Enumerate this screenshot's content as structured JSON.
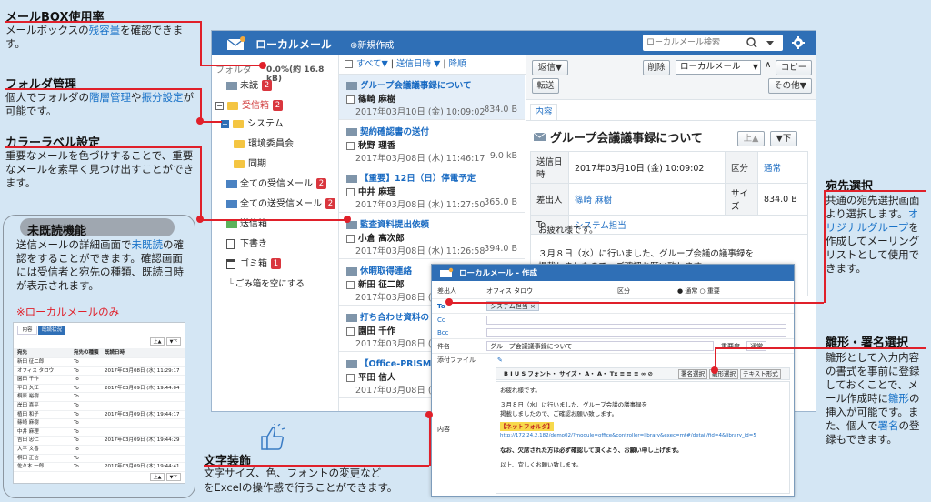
{
  "annotations": {
    "mailbox": {
      "title": "メールBOX使用率",
      "text1": "メールボックスの",
      "text2": "残容量",
      "text3": "を確認できます。"
    },
    "folder": {
      "title": "フォルダ管理",
      "text1": "個人でフォルダの",
      "text2": "階層管理",
      "text3": "や",
      "text4": "振分設定",
      "text5": "が可能です。"
    },
    "color": {
      "title": "カラーラベル設定",
      "text": "重要なメールを色づけすることで、重要なメールを素早く見つけ出すことができます。"
    },
    "unread": {
      "title": "未既読機能",
      "text1": "送信メールの詳細画面で",
      "text2": "未既読",
      "text3": "の確認をすることができます。確認画面には受信者と宛先の種類、既読日時が表示されます。",
      "note": "※ローカルメールのみ"
    },
    "recipient": {
      "title": "宛先選択",
      "text1": "共通の宛先選択画面より選択します。",
      "text2": "オリジナルグループ",
      "text3": "を作成してメーリングリストとして使用できます。"
    },
    "template": {
      "title": "雛形・署名選択",
      "text1": "雛形として入力内容の書式を事前に登録しておくことで、メール作成時に",
      "text2": "雛形",
      "text3": "の挿入が可能です。また、個人で",
      "text4": "署名",
      "text5": "の登録もできます。"
    },
    "deco": {
      "title": "文字装飾",
      "text1": "文字サイズ、色、フォントの変更など",
      "text2": "をExcelの操作感で行うことができます。"
    }
  },
  "app": {
    "title": "ローカルメール",
    "new_button": "⊕新規作成",
    "search_placeholder": "ローカルメール検索",
    "folder_label": "フォルダ",
    "usage": "0.0%(約 16.8 kB)",
    "folders": [
      {
        "label": "未読",
        "badge": "2"
      },
      {
        "label": "受信箱",
        "badge": "2"
      },
      {
        "label": "システム",
        "badge": ""
      },
      {
        "label": "環境委員会",
        "badge": ""
      },
      {
        "label": "同期",
        "badge": ""
      },
      {
        "label": "全ての受信メール",
        "badge": "2"
      },
      {
        "label": "全ての送受信メール",
        "badge": "2"
      },
      {
        "label": "送信箱",
        "badge": ""
      },
      {
        "label": "下書き",
        "badge": ""
      },
      {
        "label": "ゴミ箱",
        "badge": "1"
      },
      {
        "label": "ごみ箱を空にする",
        "badge": ""
      }
    ],
    "list_toolbar": {
      "all": "すべて▼",
      "sort": "送信日時 ▼",
      "order": "降順"
    },
    "mails": [
      {
        "subject": "グループ会議議事録について",
        "from": "篠崎 麻樹",
        "date": "2017年03月10日 (金) 10:09:02",
        "size": "834.0 B"
      },
      {
        "subject": "契約確認書の送付",
        "from": "秋野 理香",
        "date": "2017年03月08日 (水) 11:46:17",
        "size": "9.0 kB"
      },
      {
        "subject": "【重要】12日（日）停電予定",
        "from": "中井 麻理",
        "date": "2017年03月08日 (水) 11:27:50",
        "size": "365.0 B"
      },
      {
        "subject": "監査資料提出依頼",
        "from": "小倉 高次郎",
        "date": "2017年03月08日 (水) 11:26:58",
        "size": "394.0 B"
      },
      {
        "subject": "休暇取得連絡",
        "from": "新田 征二郎",
        "date": "2017年03月08日 (水)",
        "size": ""
      },
      {
        "subject": "打ち合わせ資料の",
        "from": "園田 千作",
        "date": "2017年03月08日 (水)",
        "size": ""
      },
      {
        "subject": "【Office-PRISM】",
        "from": "平田 信人",
        "date": "2017年03月08日 (水)",
        "size": ""
      }
    ],
    "detail": {
      "reply": "返信▼",
      "forward": "転送",
      "delete": "削除",
      "move_select": "ローカルメール",
      "copy": "コピー",
      "other": "その他▼",
      "tab": "内容",
      "subject": "グループ会議議事録について",
      "prev": "上▲",
      "next": "▼下",
      "labels": {
        "sent": "送信日時",
        "from": "差出人",
        "to": "To",
        "category": "区分",
        "size": "サイズ"
      },
      "sent": "2017年03月10日 (金) 10:09:02",
      "from": "篠崎 麻樹",
      "to": "システム担当",
      "category": "通常",
      "size": "834.0 B",
      "body1": "お疲れ様です。",
      "body2": "３月８日（水）に行いました、グループ会議の議事録を",
      "body3": "掲載しましたので、ご確認お願い致します。"
    }
  },
  "compose": {
    "title": "ローカルメール - 作成",
    "from_label": "差出人",
    "from_value": "オフィス タロウ",
    "category_label": "区分",
    "category_value": "● 通常 ○ 重要",
    "to_label": "To",
    "to_value": "システム担当 ×",
    "cc_label": "Cc",
    "bcc_label": "Bcc",
    "subject_label": "件名",
    "subject_value": "グループ会議議事録について",
    "encoding_label": "重要度",
    "encoding_value": "通常",
    "attach_label": "添付ファイル",
    "toolbar": "B  I  U  S  フォント・  サイズ・  A・  A・  Tx  ≡  ≡  ≡  ∞  ⊘",
    "sign": "署名選択",
    "template": "雛形選択",
    "textfmt": "テキスト形式",
    "content_label": "内容",
    "body1": "お疲れ様です。",
    "body2": "３月８日（水）に行いました、グループ会議の議事録を",
    "body3": "掲載しましたので、ご確認お願い致します。",
    "body4": "【ネットフォルダ】",
    "body5": "http://172.24.2.182/demo02/?module=office&controller=library&exec=mt#/detail/fid=4&library_id=5",
    "body6": "なお、欠席された方は必ず確認して頂くよう、お願い申し上げます。",
    "body7": "以上、宜しくお願い致します。"
  },
  "mini": {
    "tabs": [
      "内容",
      "既読状況"
    ],
    "headers": [
      "宛先",
      "宛先の種類",
      "既読日時"
    ],
    "rows": [
      [
        "新田 征二郎",
        "To",
        ""
      ],
      [
        "オフィス タロウ",
        "To",
        "2017年03月08日 (水) 11:29:17"
      ],
      [
        "園田 千作",
        "To",
        ""
      ],
      [
        "平田 久江",
        "To",
        "2017年03月09日 (木) 19:44:04"
      ],
      [
        "桐原 裕樹",
        "To",
        ""
      ],
      [
        "岸田 喜平",
        "To",
        ""
      ],
      [
        "植田 和子",
        "To",
        "2017年03月09日 (木) 19:44:17"
      ],
      [
        "篠崎 麻樹",
        "To",
        ""
      ],
      [
        "中井 麻理",
        "To",
        ""
      ],
      [
        "吉田 忠仁",
        "To",
        "2017年03月09日 (木) 19:44:29"
      ],
      [
        "大平 文香",
        "To",
        ""
      ],
      [
        "桐田 正信",
        "To",
        ""
      ],
      [
        "佐々木 一郎",
        "To",
        "2017年03月09日 (木) 19:44:41"
      ]
    ],
    "nav_up": "上▲",
    "nav_down": "▼下"
  }
}
